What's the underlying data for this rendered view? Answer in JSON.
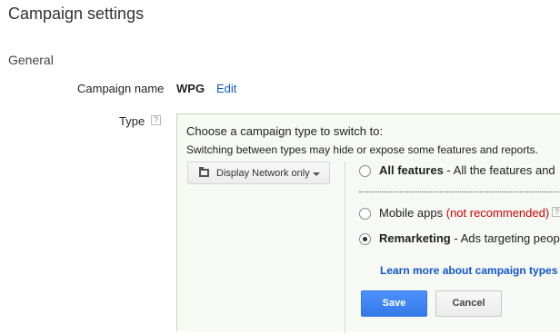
{
  "page": {
    "title": "Campaign settings"
  },
  "section": {
    "title": "General"
  },
  "campaign_name": {
    "label": "Campaign name",
    "value": "WPG",
    "edit_link": "Edit"
  },
  "type": {
    "label": "Type",
    "help_glyph": "?",
    "panel": {
      "heading": "Choose a campaign type to switch to:",
      "subheading": "Switching between types may hide or expose some features and reports.",
      "dropdown": {
        "selected": "Display Network only",
        "icon": "folder-icon"
      },
      "options": [
        {
          "name": "All features",
          "description": " - All the features and",
          "checked": false
        },
        {
          "name": "Mobile apps",
          "note": "(not recommended)",
          "checked": false
        },
        {
          "name": "Remarketing",
          "description": " - Ads targeting peop",
          "checked": true
        }
      ],
      "learn_more": "Learn more about campaign types",
      "save_label": "Save",
      "cancel_label": "Cancel"
    }
  },
  "colors": {
    "link": "#1155cc",
    "primary_button": "#4d90fe",
    "warning_text": "#cc0000",
    "panel_bg": "#f7f9f5"
  }
}
